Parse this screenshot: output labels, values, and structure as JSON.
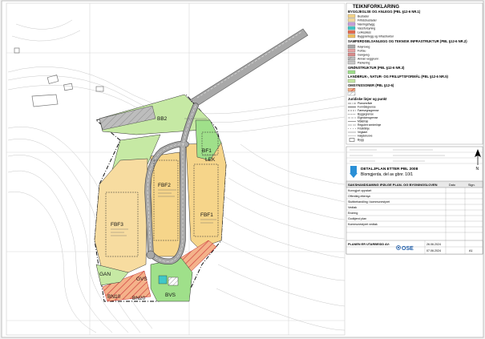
{
  "legend": {
    "title": "TEIKNFORKLARING",
    "section1": "BYGGJEGLSE OG ANLEGG (PBL §12-6 NR.1)",
    "section1_items": [
      "Bustader",
      "Fritidsbustader",
      "Næringsbygg",
      "Vassforsyning",
      "Leikeplass",
      "Bygg/anlegg og infrastruktur"
    ],
    "section2": "SAMFERDSELSANLEGG OG TEKNISK INFRASTRUKTUR (PBL §12-6 NR.2)",
    "section2_items": [
      "Køyreveg",
      "Fortau",
      "Gangveg",
      "Annan veggrunn",
      "Parkering"
    ],
    "section3": "GRØNSTRUKTUR (PBL §12-6 NR.3)",
    "section4": "LANDBRUK-, NATUR- OG FRILUFTSFORMÅL (PBL §12-6 NR.5)",
    "section5": "OMSYNSSONER (PBL §12-6)",
    "section6": "Juridiske linjer og punkt",
    "lines": [
      "Planområde",
      "Formålsgrense",
      "Føresegnsgrense",
      "Byggegrense",
      "Eigedomsgrense",
      "Målelinje",
      "Regulert senterlinje",
      "Frisiktlinje",
      "Vegkant",
      "Høgdekurve",
      "Bygg"
    ]
  },
  "plan": {
    "title": "DETALJPLAN ETTER PBL 2008",
    "name": "Blomgjerda, del av gbnr. 10/1",
    "handling_title": "SAKSHANDSAMING IFØLGE PLAN- OG BYGNINGSLOVEN",
    "columns": [
      "Dato",
      "Sign."
    ],
    "rows": [
      "Kunngjort oppstart",
      "Offentleg ettersyn",
      "Sluttbehandling i kommunestyret",
      "Vedtak",
      "Endring",
      "Godkjend plan",
      "Kommunestyret vedtak"
    ],
    "footer_label": "PLANEN ER UTARBEIDD AV:",
    "company": "OSE",
    "date1": "26.06.2024",
    "date2": "07.06.2024",
    "sheet_size": "A1"
  },
  "zones": {
    "b_upper": "BB2",
    "b_right": "BF1",
    "f_center": "FBF2",
    "f_left": "FBF3",
    "f_low": "FBF1",
    "l_small": "LEK",
    "green_low": "BVS",
    "small1": "GAN",
    "small2": "GVS",
    "bottom1": "BN10",
    "bottom2": "BN20"
  },
  "north_label": "N",
  "colors": {
    "residential": "#f6d58a",
    "leisure": "#f7dca0",
    "green": "#9fe08a",
    "agriculture": "#c6e9a4",
    "road": "#a8a8a8",
    "water": "#40c8c8",
    "hatch": "#d04040",
    "scale_blue": "#2a8fd6"
  }
}
